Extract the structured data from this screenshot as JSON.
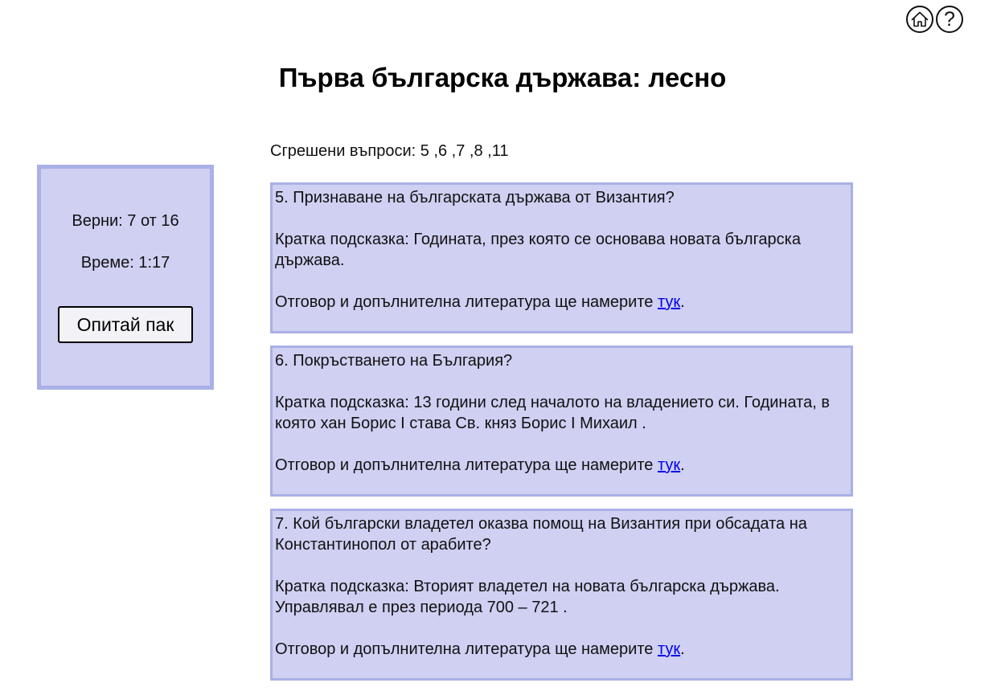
{
  "header": {
    "home_icon": "home-icon",
    "help_icon": "question-mark-icon",
    "help_glyph": "?",
    "title": "Първа българска държава: лесно"
  },
  "score_panel": {
    "correct_text": "Верни: 7 от 16",
    "time_text": "Време: 1:17",
    "retry_label": "Опитай пак"
  },
  "wrong_questions_text": "Сгрешени въпроси: 5 ,6 ,7 ,8 ,11",
  "questions": [
    {
      "question": "5. Признаване на българската държава от Византия?",
      "hint": "Кратка подсказка: Годината, през която се основава новата българска държава.",
      "answer_prefix": "Отговор и допълнителна литература ще намерите ",
      "link_text": "тук",
      "answer_suffix": "."
    },
    {
      "question": "6. Покръстването на България?",
      "hint": "Кратка подсказка: 13 години след началото на владението си. Годината, в която хан Борис I става Св. княз Борис I Михаил .",
      "answer_prefix": "Отговор и допълнителна литература ще намерите ",
      "link_text": "тук",
      "answer_suffix": "."
    },
    {
      "question": "7. Кой български владетел оказва помощ на Византия при обсадата на Константинопол от арабите?",
      "hint": "Кратка подсказка: Вторият владетел на новата българска държава. Управлявал е през периода 700 – 721 .",
      "answer_prefix": "Отговор и допълнителна литература ще намерите ",
      "link_text": "тук",
      "answer_suffix": "."
    }
  ],
  "colors": {
    "panel_background": "#cfd0f2",
    "panel_border": "#aab0e6",
    "link": "#0000ee"
  }
}
